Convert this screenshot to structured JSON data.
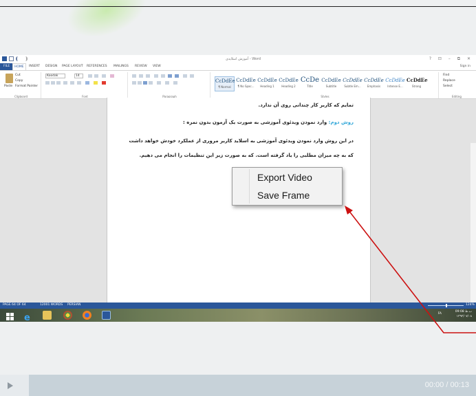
{
  "word": {
    "title": "آموزش اسلایدی - Word",
    "window_controls": "?  ⊡  –  ⧉  ✕",
    "sign_in": "Sign in",
    "tabs": [
      "FILE",
      "HOME",
      "INSERT",
      "DESIGN",
      "PAGE LAYOUT",
      "REFERENCES",
      "MAILINGS",
      "REVIEW",
      "VIEW"
    ],
    "active_tab": "HOME",
    "ribbon": {
      "clipboard": {
        "paste": "Paste",
        "cut": "Cut",
        "copy": "Copy",
        "format_painter": "Format Painter",
        "label": "Clipboard"
      },
      "font": {
        "name": "Koodak",
        "size": "14",
        "label": "Font"
      },
      "paragraph": {
        "label": "Paragraph"
      },
      "styles": {
        "label": "Styles",
        "items": [
          {
            "sample": "CcDdEe",
            "name": "¶ Normal"
          },
          {
            "sample": "CcDdEe",
            "name": "¶ No Spac..."
          },
          {
            "sample": "CcDdEe",
            "name": "Heading 1"
          },
          {
            "sample": "CcDdEe",
            "name": "Heading 2"
          },
          {
            "sample": "CcDe",
            "name": "Title"
          },
          {
            "sample": "CcDdEe",
            "name": "Subtitle"
          },
          {
            "sample": "CcDdEe",
            "name": "Subtle Em..."
          },
          {
            "sample": "CcDdEe",
            "name": "Emphasis"
          },
          {
            "sample": "CcDdEe",
            "name": "Intense E..."
          },
          {
            "sample": "CcDdEe",
            "name": "Strong"
          }
        ]
      },
      "editing": {
        "find": "Find",
        "replace": "Replace",
        "select": "Select",
        "label": "Editing"
      }
    },
    "document": {
      "line1": "تمایم که کاربر کار چندانی روی آن ندارد.",
      "line2_highlight": "روش دوم:",
      "line2_rest": " وارد نمودن ویدئوی آموزشی به صورت یک آزمون بدون نمره :",
      "line3": "در این روش وارد نمودن ویدئوی آموزشی به اسلاید کاربر مروری از عملکرد خودش خواهد داشت",
      "line4": "که به چه میزان مطلبی را یاد گرفته است. که به صورت زیر این تنظیمات را انجام می دهیم."
    },
    "status": {
      "page": "PAGE 64 OF 64",
      "words": "12001 WORDS",
      "language": "PERSIAN",
      "zoom": "124%"
    },
    "tray": {
      "lang": "FA",
      "time": "09:08 ب.ظ",
      "date": "۱۳۹۳/۰۷/۰۸"
    }
  },
  "context_menu": {
    "items": [
      "Export Video",
      "Save Frame"
    ]
  },
  "player": {
    "time": "00:00 / 00:13",
    "progress": 0
  },
  "colors": {
    "ribbon_blue": "#2b579a",
    "highlight_text": "#2fa6d8",
    "annotation_arrow": "#cc1111",
    "player_bar": "#c7d2d9"
  }
}
